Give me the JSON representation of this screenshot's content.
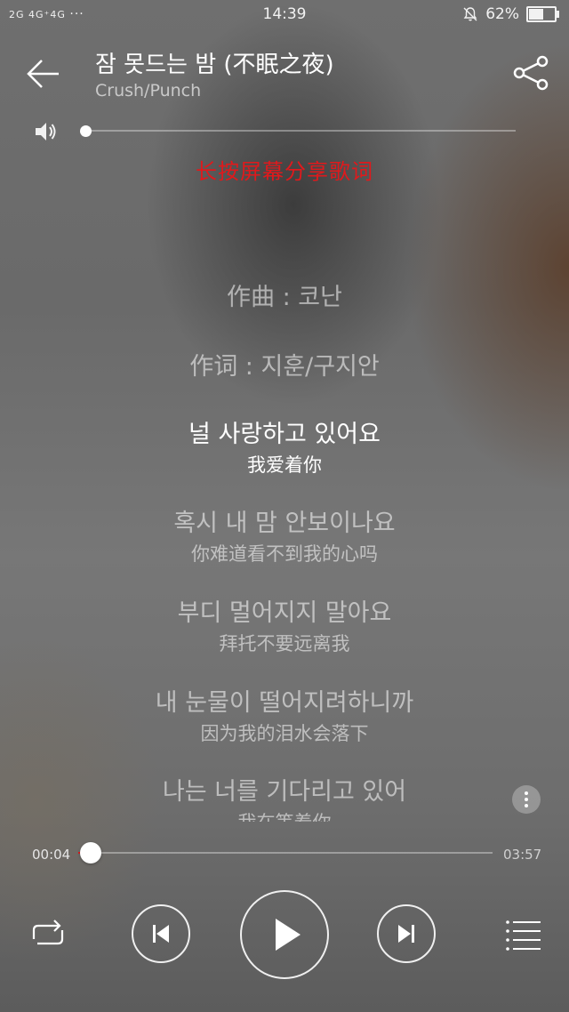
{
  "status_bar": {
    "signal_text": "2G 4G⁺4G",
    "more_dots": "···",
    "time": "14:39",
    "battery": "62%",
    "battery_level": 0.62
  },
  "header": {
    "title": "잠 못드는 밤  (不眠之夜)",
    "artist": "Crush/Punch"
  },
  "volume": {
    "level": 0.0
  },
  "share_hint": "长按屏幕分享歌词",
  "lyrics": {
    "credits": [
      "作曲 : 코난",
      "作词 : 지훈/구지안"
    ],
    "lines": [
      {
        "ko": "널 사랑하고 있어요",
        "zh": "我爱着你",
        "current": true
      },
      {
        "ko": "혹시 내 맘 안보이나요",
        "zh": "你难道看不到我的心吗"
      },
      {
        "ko": "부디 멀어지지 말아요",
        "zh": "拜托不要远离我"
      },
      {
        "ko": "내 눈물이 떨어지려하니까",
        "zh": "因为我的泪水会落下"
      },
      {
        "ko": "나는 너를 기다리고 있어",
        "zh": "我在等着你"
      }
    ]
  },
  "progress": {
    "current": "00:04",
    "total": "03:57",
    "fraction": 0.017
  },
  "icons": {
    "back": "arrow-left-icon",
    "share": "share-icon",
    "volume": "speaker-icon",
    "repeat": "repeat-icon",
    "prev": "skip-previous-icon",
    "play": "play-icon",
    "next": "skip-next-icon",
    "playlist": "playlist-icon",
    "more": "more-vertical-icon"
  },
  "colors": {
    "accent": "#e0191c"
  }
}
